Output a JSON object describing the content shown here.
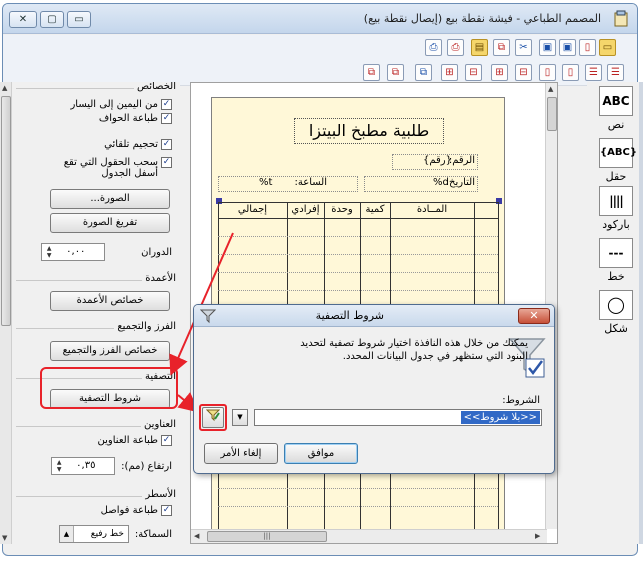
{
  "window": {
    "title": "المصمم الطباعي - فيشة نقطة بيع (إيصال نقطة بيع)",
    "controls": {
      "close": "✕",
      "maximize": "▢",
      "minimize": "▭"
    }
  },
  "left_panel": {
    "group_properties": {
      "title": "الخصائص",
      "rtl": "من اليمين إلى اليسار",
      "print_borders": "طباعة الحواف",
      "auto_size": "تحجيم تلقائي",
      "stretch_bottom": "سحب الحقول التي تقع أسفل الجدول",
      "image_btn": "الصورة...",
      "clear_image_btn": "تفريغ الصورة",
      "rotation_label": "الدوران",
      "rotation_value": "٠,٠٠"
    },
    "group_columns": {
      "title": "الأعمدة",
      "props_btn": "خصائص الأعمدة"
    },
    "group_sorting": {
      "title": "الفرز والتجميع",
      "props_btn": "خصائص الفرز والتجميع"
    },
    "group_filter": {
      "title": "التصفية",
      "conditions_btn": "شروط التصفية"
    },
    "group_headers": {
      "title": "العناوين",
      "print_headers": "طباعة العناوين",
      "height_label": "ارتفاع (مم):",
      "height_value": "٠,٣٥"
    },
    "group_lines": {
      "title": "الأسطر",
      "print_separators": "طباعة فواصل",
      "thickness_label": "السماكة:",
      "thickness_value": "خط رفيع"
    }
  },
  "report": {
    "title": "طلبية مطبخ  البيتزا",
    "number_label": "الرقم:",
    "number_value": "{رقم}",
    "date_label": "التاريخ:",
    "date_value": "d%",
    "time_label": "الساعة:",
    "time_value": "t%",
    "columns": [
      "المــادة",
      "كمية",
      "وحدة",
      "إفرادي",
      "إجمالي"
    ]
  },
  "tools": [
    {
      "icon": "ABC",
      "label": "نص"
    },
    {
      "icon": "{ABC}",
      "label": "حقل"
    },
    {
      "icon": "||||",
      "label": "باركود"
    },
    {
      "icon": "---",
      "label": "خط"
    },
    {
      "icon": "◯",
      "label": "شكل"
    }
  ],
  "dialog": {
    "title": "شروط التصفية",
    "description": "يمكنك من خلال هذه النافذة اختيار شروط تصفية لتحديد البنود التي ستظهر في جدول البيانات المحدد.",
    "conditions_label": "الشروط:",
    "conditions_value": "<<بلا شروط>>",
    "ok_btn": "موافق",
    "cancel_btn": "إلغاء الأمر"
  }
}
